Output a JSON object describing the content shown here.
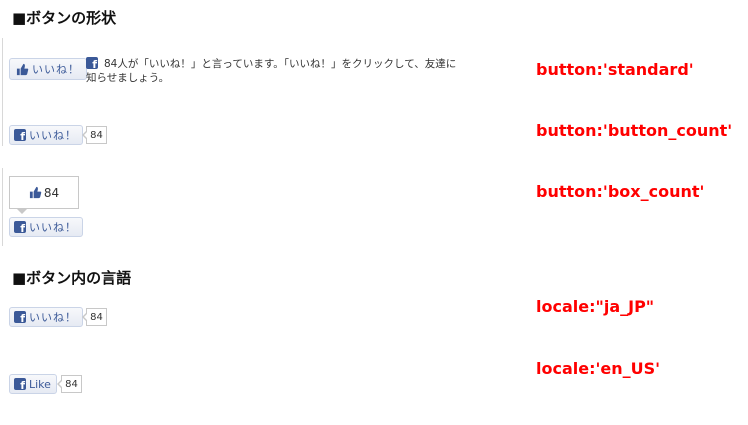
{
  "sections": {
    "shape_heading": "■ボタンの形状",
    "locale_heading": "■ボタン内の言語"
  },
  "like_label_ja": "いいね！",
  "like_label_en": "Like",
  "count": "84",
  "standard_text": "84人が「いいね！」と言っています。「いいね！」をクリックして、友達に知らせましょう。",
  "labels": {
    "standard": "button:'standard'",
    "button_count": "button:'button_count'",
    "box_count": "button:'box_count'",
    "ja_jp": "locale:\"ja_JP\"",
    "en_us": "locale:'en_US'"
  },
  "icons": {
    "facebook": "facebook-f-icon",
    "thumb": "thumbs-up-icon"
  },
  "colors": {
    "label_red": "#ff0000",
    "facebook_blue": "#3b5998"
  }
}
